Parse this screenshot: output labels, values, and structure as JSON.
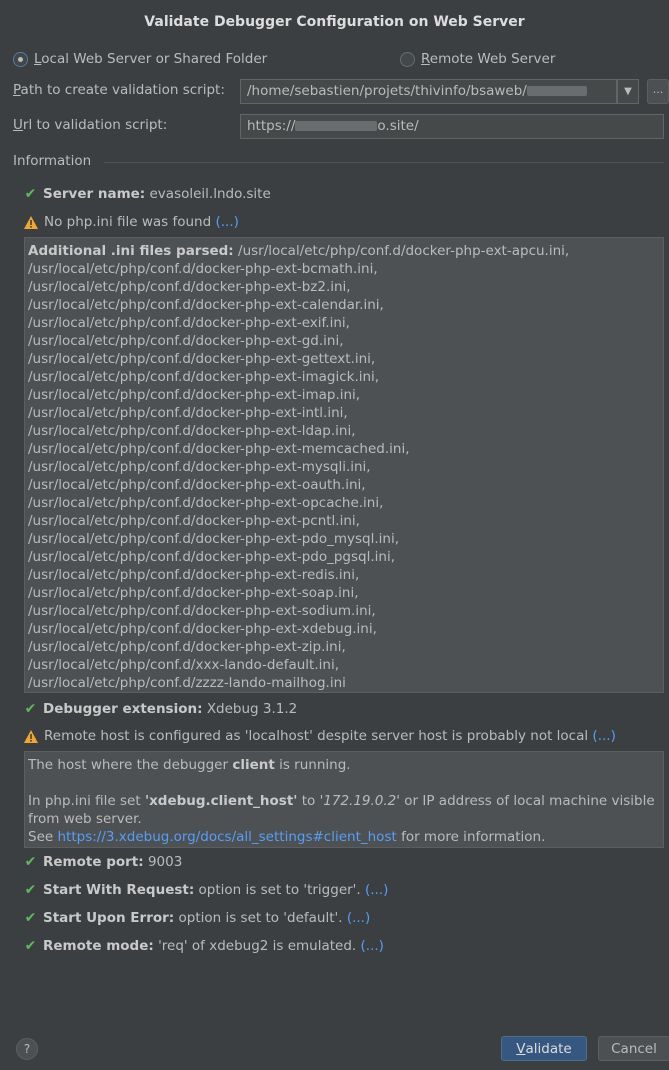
{
  "dialog": {
    "title": "Validate Debugger Configuration on Web Server"
  },
  "mode": {
    "local_label": "Local Web Server or Shared Folder",
    "local_accel": "L",
    "local_rest": "ocal Web Server or Shared Folder",
    "remote_accel": "R",
    "remote_rest": "emote Web Server",
    "selected": "local"
  },
  "path_field": {
    "label_accel": "P",
    "label_rest": "ath to create validation script:",
    "value": "/home/sebastien/projets/thivinfo/bsaweb/",
    "browse_label": "..."
  },
  "url_field": {
    "label_accel": "U",
    "label_rest": "rl to validation script:",
    "value_prefix": "https://",
    "value_suffix": "o.site/"
  },
  "information": {
    "section_title": "Information",
    "server_name_label": "Server name:",
    "server_name_value": "evasoleil.lndo.site",
    "no_phpini": "No php.ini file was found",
    "more": "(...)",
    "ini_header": "Additional .ini files parsed:",
    "ini_files": [
      "/usr/local/etc/php/conf.d/docker-php-ext-apcu.ini,",
      "/usr/local/etc/php/conf.d/docker-php-ext-bcmath.ini,",
      "/usr/local/etc/php/conf.d/docker-php-ext-bz2.ini,",
      "/usr/local/etc/php/conf.d/docker-php-ext-calendar.ini,",
      "/usr/local/etc/php/conf.d/docker-php-ext-exif.ini,",
      "/usr/local/etc/php/conf.d/docker-php-ext-gd.ini,",
      "/usr/local/etc/php/conf.d/docker-php-ext-gettext.ini,",
      "/usr/local/etc/php/conf.d/docker-php-ext-imagick.ini,",
      "/usr/local/etc/php/conf.d/docker-php-ext-imap.ini,",
      "/usr/local/etc/php/conf.d/docker-php-ext-intl.ini,",
      "/usr/local/etc/php/conf.d/docker-php-ext-ldap.ini,",
      "/usr/local/etc/php/conf.d/docker-php-ext-memcached.ini,",
      "/usr/local/etc/php/conf.d/docker-php-ext-mysqli.ini,",
      "/usr/local/etc/php/conf.d/docker-php-ext-oauth.ini,",
      "/usr/local/etc/php/conf.d/docker-php-ext-opcache.ini,",
      "/usr/local/etc/php/conf.d/docker-php-ext-pcntl.ini,",
      "/usr/local/etc/php/conf.d/docker-php-ext-pdo_mysql.ini,",
      "/usr/local/etc/php/conf.d/docker-php-ext-pdo_pgsql.ini,",
      "/usr/local/etc/php/conf.d/docker-php-ext-redis.ini,",
      "/usr/local/etc/php/conf.d/docker-php-ext-soap.ini,",
      "/usr/local/etc/php/conf.d/docker-php-ext-sodium.ini,",
      "/usr/local/etc/php/conf.d/docker-php-ext-xdebug.ini,",
      "/usr/local/etc/php/conf.d/docker-php-ext-zip.ini,",
      "/usr/local/etc/php/conf.d/xxx-lando-default.ini,",
      "/usr/local/etc/php/conf.d/zzzz-lando-mailhog.ini"
    ],
    "debugger_ext_label": "Debugger extension:",
    "debugger_ext_value": "Xdebug 3.1.2",
    "remote_host_warning": "Remote host is configured as 'localhost' despite server host is probably not local",
    "host_panel": {
      "line1_pre": "The host where the debugger ",
      "line1_bold": "client",
      "line1_post": " is running.",
      "line2_pre": "In php.ini file set ",
      "line2_bold": "'xdebug.client_host'",
      "line2_mid": " to ",
      "line2_ip": "'172.19.0.2'",
      "line2_post": " or IP address of local machine visible",
      "line3": "from web server.",
      "line4_pre": "See ",
      "line4_link": "https://3.xdebug.org/docs/all_settings#client_host",
      "line4_post": " for more information."
    },
    "remote_port_label": "Remote port:",
    "remote_port_value": "9003",
    "start_request_label": "Start With Request:",
    "start_request_value": "option is set to 'trigger'.",
    "start_error_label": "Start Upon Error:",
    "start_error_value": "option is set to 'default'.",
    "remote_mode_label": "Remote mode:",
    "remote_mode_value": "'req' of xdebug2 is emulated."
  },
  "footer": {
    "help_label": "?",
    "validate_accel": "V",
    "validate_rest": "alidate",
    "cancel_label": "Cancel"
  },
  "colors": {
    "background": "#3c3f41",
    "primary_button": "#365880",
    "link": "#589df6",
    "success": "#5fb85f",
    "warning": "#f0a732"
  }
}
